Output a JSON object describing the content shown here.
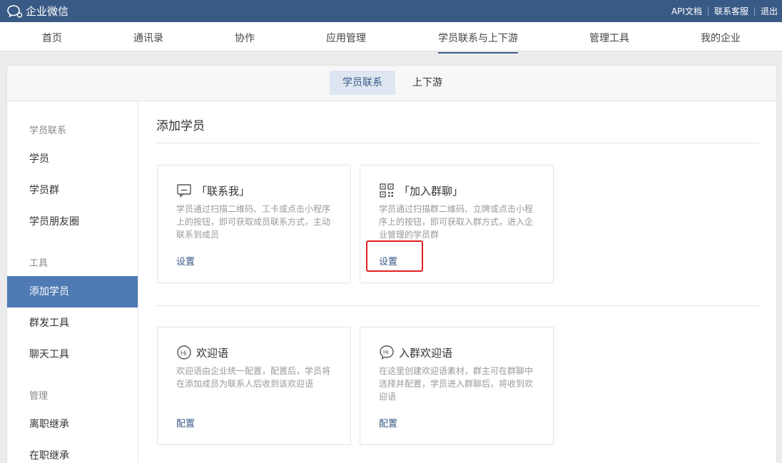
{
  "app": {
    "title": "企业微信"
  },
  "toplinks": [
    "API文档",
    "联系客服",
    "退出"
  ],
  "mainnav": {
    "items": [
      {
        "label": "首页"
      },
      {
        "label": "通讯录"
      },
      {
        "label": "协作"
      },
      {
        "label": "应用管理"
      },
      {
        "label": "学员联系与上下游",
        "active": true
      },
      {
        "label": "管理工具"
      },
      {
        "label": "我的企业"
      }
    ]
  },
  "subtabs": [
    {
      "label": "学员联系",
      "active": true
    },
    {
      "label": "上下游"
    }
  ],
  "sidebar": {
    "groups": [
      "学员联系",
      "工具",
      "管理"
    ],
    "items": [
      "学员",
      "学员群",
      "学员朋友圈",
      "添加学员",
      "群发工具",
      "聊天工具",
      "离职继承",
      "在职继承"
    ],
    "active_item": "添加学员"
  },
  "content": {
    "title": "添加学员",
    "cards": [
      {
        "icon": "chat-bubble-icon",
        "title": "「联系我」",
        "desc": "学员通过扫描二维码、工卡或点击小程序上的按钮，即可获取成员联系方式，主动联系到成员",
        "action": "设置"
      },
      {
        "icon": "qr-code-icon",
        "title": "「加入群聊」",
        "desc": "学员通过扫描群二维码、立牌或点击小程序上的按钮，即可获取入群方式，进入企业管理的学员群",
        "action": "设置"
      },
      {
        "icon": "hi-bubble-icon",
        "title": "欢迎语",
        "desc": "欢迎语由企业统一配置，配置后，学员将在添加成员为联系人后收到该欢迎语",
        "action": "配置"
      },
      {
        "icon": "hi-group-bubble-icon",
        "title": "入群欢迎语",
        "desc": "在这里创建欢迎语素材，群主可在群聊中选择并配置，学员进入群聊后，将收到欢迎语",
        "action": "配置"
      }
    ]
  },
  "colors": {
    "topbar": "#3a5a86",
    "accent": "#4f7ab3",
    "highlight": "#e02020"
  }
}
